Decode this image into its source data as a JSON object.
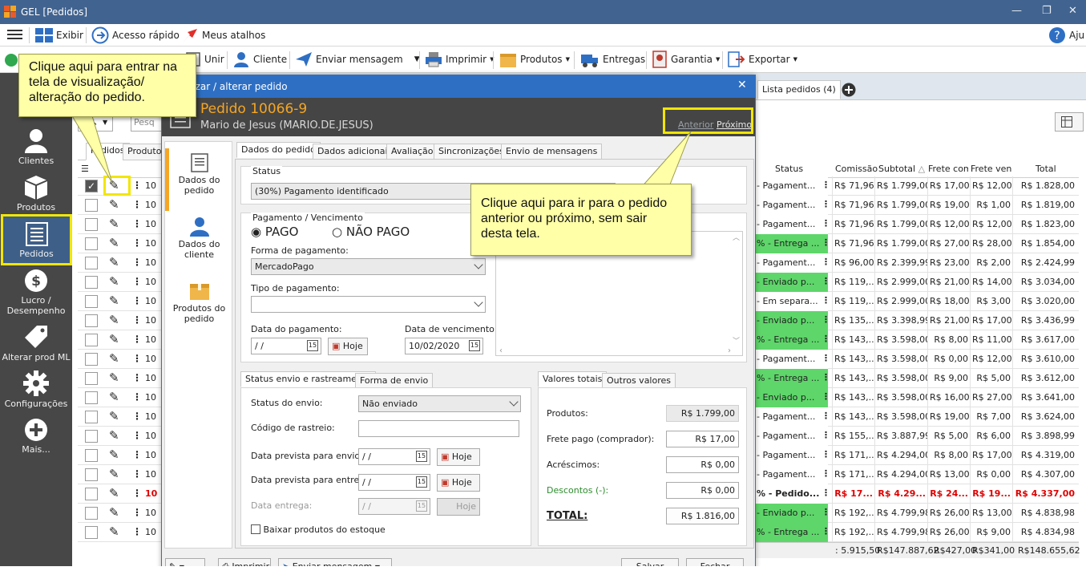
{
  "window": {
    "title": "GEL [Pedidos]"
  },
  "menubar": {
    "exibir": "Exibir",
    "acesso_rapido": "Acesso rápido",
    "meus_atalhos": "Meus atalhos",
    "ajuda": "Aju"
  },
  "toolbar": {
    "unir": "Unir",
    "cliente": "Cliente",
    "enviar_mensagem": "Enviar mensagem",
    "imprimir": "Imprimir",
    "produtos": "Produtos",
    "entregas": "Entregas",
    "garantia": "Garantia",
    "exportar": "Exportar"
  },
  "sidebar": {
    "items": [
      {
        "label": "Clientes"
      },
      {
        "label": "Produtos"
      },
      {
        "label": "Pedidos"
      },
      {
        "label": "Lucro / Desempenho"
      },
      {
        "label": "Alterar prod ML"
      },
      {
        "label": "Configurações"
      },
      {
        "label": "Mais..."
      }
    ]
  },
  "list_tabs": {
    "lista_pedidos": "Lista pedidos (4)",
    "pedidos": "Pedidos",
    "produtos": "Produtos",
    "search_placeholder": "Pesq"
  },
  "grid": {
    "headers": {
      "status": "Status",
      "comissao": "Comissão",
      "subtotal": "Subtotal",
      "frete_comp": "Frete comp",
      "frete_vend": "Frete vend",
      "total": "Total"
    },
    "order_prefix": "10",
    "rows": [
      {
        "status": "- Pagament...",
        "green": false,
        "comissao": "R$ 71,96",
        "subtotal": "R$ 1.799,00",
        "frete_comp": "R$ 17,00",
        "frete_vend": "R$ 12,00",
        "total": "R$ 1.828,00",
        "bold": false
      },
      {
        "status": "- Pagament...",
        "green": false,
        "comissao": "R$ 71,96",
        "subtotal": "R$ 1.799,00",
        "frete_comp": "R$ 19,00",
        "frete_vend": "R$ 1,00",
        "total": "R$ 1.819,00",
        "bold": false
      },
      {
        "status": "- Pagament...",
        "green": false,
        "comissao": "R$ 71,96",
        "subtotal": "R$ 1.799,00",
        "frete_comp": "R$ 12,00",
        "frete_vend": "R$ 12,00",
        "total": "R$ 1.823,00",
        "bold": false
      },
      {
        "status": "% - Entrega ...",
        "green": true,
        "comissao": "R$ 71,96",
        "subtotal": "R$ 1.799,00",
        "frete_comp": "R$ 27,00",
        "frete_vend": "R$ 28,00",
        "total": "R$ 1.854,00",
        "bold": false
      },
      {
        "status": "- Pagament...",
        "green": false,
        "comissao": "R$ 96,00",
        "subtotal": "R$ 2.399,99",
        "frete_comp": "R$ 23,00",
        "frete_vend": "R$ 2,00",
        "total": "R$ 2.424,99",
        "bold": false
      },
      {
        "status": "- Enviado p...",
        "green": true,
        "comissao": "R$ 119,...",
        "subtotal": "R$ 2.999,00",
        "frete_comp": "R$ 21,00",
        "frete_vend": "R$ 14,00",
        "total": "R$ 3.034,00",
        "bold": false
      },
      {
        "status": "- Em separa...",
        "green": false,
        "comissao": "R$ 119,...",
        "subtotal": "R$ 2.999,00",
        "frete_comp": "R$ 18,00",
        "frete_vend": "R$ 3,00",
        "total": "R$ 3.020,00",
        "bold": false
      },
      {
        "status": "- Enviado p...",
        "green": true,
        "comissao": "R$ 135,...",
        "subtotal": "R$ 3.398,99",
        "frete_comp": "R$ 21,00",
        "frete_vend": "R$ 17,00",
        "total": "R$ 3.436,99",
        "bold": false
      },
      {
        "status": "% - Entrega ...",
        "green": true,
        "comissao": "R$ 143,...",
        "subtotal": "R$ 3.598,00",
        "frete_comp": "R$ 8,00",
        "frete_vend": "R$ 11,00",
        "total": "R$ 3.617,00",
        "bold": false
      },
      {
        "status": "- Pagament...",
        "green": false,
        "comissao": "R$ 143,...",
        "subtotal": "R$ 3.598,00",
        "frete_comp": "R$ 0,00",
        "frete_vend": "R$ 12,00",
        "total": "R$ 3.610,00",
        "bold": false
      },
      {
        "status": "% - Entrega ...",
        "green": true,
        "comissao": "R$ 143,...",
        "subtotal": "R$ 3.598,00",
        "frete_comp": "R$ 9,00",
        "frete_vend": "R$ 5,00",
        "total": "R$ 3.612,00",
        "bold": false
      },
      {
        "status": "- Enviado p...",
        "green": true,
        "comissao": "R$ 143,...",
        "subtotal": "R$ 3.598,00",
        "frete_comp": "R$ 16,00",
        "frete_vend": "R$ 27,00",
        "total": "R$ 3.641,00",
        "bold": false
      },
      {
        "status": "- Pagament...",
        "green": false,
        "comissao": "R$ 143,...",
        "subtotal": "R$ 3.598,00",
        "frete_comp": "R$ 19,00",
        "frete_vend": "R$ 7,00",
        "total": "R$ 3.624,00",
        "bold": false
      },
      {
        "status": "- Pagament...",
        "green": false,
        "comissao": "R$ 155,...",
        "subtotal": "R$ 3.887,99",
        "frete_comp": "R$ 5,00",
        "frete_vend": "R$ 6,00",
        "total": "R$ 3.898,99",
        "bold": false
      },
      {
        "status": "- Pagament...",
        "green": false,
        "comissao": "R$ 171,...",
        "subtotal": "R$ 4.294,00",
        "frete_comp": "R$ 8,00",
        "frete_vend": "R$ 17,00",
        "total": "R$ 4.319,00",
        "bold": false
      },
      {
        "status": "- Pagament...",
        "green": false,
        "comissao": "R$ 171,...",
        "subtotal": "R$ 4.294,00",
        "frete_comp": "R$ 13,00",
        "frete_vend": "R$ 0,00",
        "total": "R$ 4.307,00",
        "bold": false
      },
      {
        "status": "% - Pedido...",
        "green": false,
        "comissao": "R$ 17...",
        "subtotal": "R$ 4.29...",
        "frete_comp": "R$ 24...",
        "frete_vend": "R$ 19...",
        "total": "R$ 4.337,00",
        "bold": true
      },
      {
        "status": "- Enviado p...",
        "green": true,
        "comissao": "R$ 192,...",
        "subtotal": "R$ 4.799,98",
        "frete_comp": "R$ 26,00",
        "frete_vend": "R$ 13,00",
        "total": "R$ 4.838,98",
        "bold": false
      },
      {
        "status": "% - Entrega ...",
        "green": true,
        "comissao": "R$ 192,...",
        "subtotal": "R$ 4.799,98",
        "frete_comp": "R$ 26,00",
        "frete_vend": "R$ 9,00",
        "total": "R$ 4.834,98",
        "bold": false
      }
    ],
    "totals": {
      "comissao": ": 5.915,50",
      "subtotal": "R$147.887,62",
      "frete_comp": "R$427,00",
      "frete_vend": "R$341,00",
      "total": "R$148.655,62"
    }
  },
  "dialog": {
    "title": "ualizar / alterar pedido",
    "order_title": "Pedido 10066-9",
    "customer": "Mario de Jesus (MARIO.DE.JESUS)",
    "nav_prev": "Anterior",
    "nav_next": "Próximo",
    "side": [
      "Dados do pedido",
      "Dados do cliente",
      "Produtos do pedido"
    ],
    "tabs": [
      "Dados do pedido",
      "Dados adicionais",
      "Avaliação",
      "Sincronizações",
      "Envio de mensagens"
    ],
    "status_group": "Status",
    "status_value": "(30%) Pagamento identificado",
    "payment_group": "Pagamento / Vencimento",
    "pago": "PAGO",
    "nao_pago": "NÃO PAGO",
    "forma_pagamento_label": "Forma de pagamento:",
    "forma_pagamento_value": "MercadoPago",
    "tipo_pagamento_label": "Tipo de pagamento:",
    "data_pagamento_label": "Data do pagamento:",
    "data_pagamento_value": " /  /",
    "hoje": "Hoje",
    "data_vencimento_label": "Data de vencimento:",
    "data_vencimento_value": "10/02/2020",
    "ship_tabs": [
      "Status envio e rastreamento",
      "Forma de envio"
    ],
    "status_envio_label": "Status do envio:",
    "status_envio_value": "Não enviado",
    "codigo_rastreio_label": "Código de rastreio:",
    "data_prev_envio_label": "Data prevista para envio:",
    "data_prev_entrega_label": "Data prevista para entrega:",
    "data_entrega_label": "Data entrega:",
    "empty_date": " /  /",
    "baixar_estoque": "Baixar produtos do estoque",
    "values_tabs": [
      "Valores totais",
      "Outros valores"
    ],
    "produtos_label": "Produtos:",
    "produtos_value": "R$ 1.799,00",
    "frete_label": "Frete pago (comprador):",
    "frete_value": "R$ 17,00",
    "acrescimos_label": "Acréscimos:",
    "acrescimos_value": "R$ 0,00",
    "descontos_label": "Descontos (-):",
    "descontos_value": "R$ 0,00",
    "total_label": "TOTAL:",
    "total_value": "R$ 1.816,00",
    "footer": {
      "imprimir": "Imprimir",
      "enviar_mensagem": "Enviar mensagem",
      "salvar": "Salvar",
      "fechar": "Fechar"
    }
  },
  "callouts": {
    "edit": "Clique aqui para entrar na tela de visualização/ alteração do pedido.",
    "nav": "Clique aqui para ir para o pedido anterior ou próximo, sem sair desta tela."
  },
  "colors": {
    "titlebar": "#41638f",
    "dialog_title": "#2e6fc4",
    "order_title": "#f5a623",
    "highlight": "#f2e600",
    "status_green": "#5ed66a",
    "callout": "#ffffa8"
  }
}
